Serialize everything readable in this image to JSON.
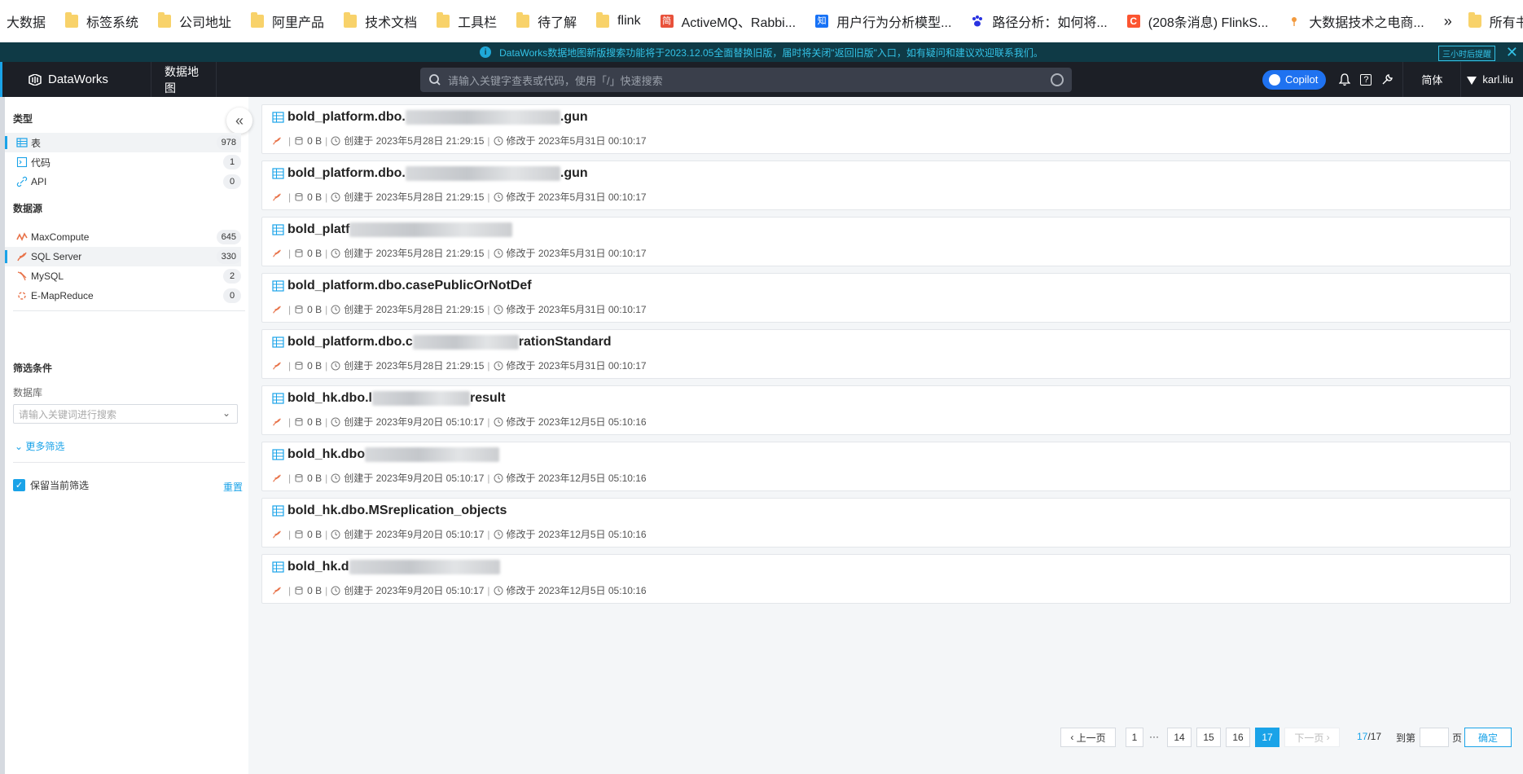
{
  "bookmarks": {
    "items": [
      {
        "label": "大数据",
        "icon": "none"
      },
      {
        "label": "标签系统",
        "icon": "folder-icon"
      },
      {
        "label": "公司地址",
        "icon": "folder-icon"
      },
      {
        "label": "阿里产品",
        "icon": "folder-icon"
      },
      {
        "label": "技术文档",
        "icon": "folder-icon"
      },
      {
        "label": "工具栏",
        "icon": "folder-icon"
      },
      {
        "label": "待了解",
        "icon": "folder-icon"
      },
      {
        "label": "flink",
        "icon": "folder-icon"
      },
      {
        "label": "ActiveMQ、Rabbi...",
        "icon": "site-icon-jian"
      },
      {
        "label": "用户行为分析模型...",
        "icon": "site-icon-zhihu"
      },
      {
        "label": "路径分析：如何将...",
        "icon": "site-icon-baidu"
      },
      {
        "label": "(208条消息) FlinkS...",
        "icon": "site-icon-csdn"
      },
      {
        "label": "大数据技术之电商...",
        "icon": "site-icon-pin"
      }
    ],
    "more": "»",
    "all": "所有书签"
  },
  "notice": {
    "text": "DataWorks数据地图新版搜索功能将于2023.12.05全面替换旧版，届时将关闭\"返回旧版\"入口，如有疑问和建议欢迎联系我们。",
    "button": "三小时后提醒",
    "close": "✕"
  },
  "topbar": {
    "brand": "DataWorks",
    "nav": "数据地图",
    "search_placeholder": "请输入关键字查表或代码，使用「/」快速搜索",
    "copilot": "Copilot",
    "lang": "简体",
    "user": "karl.liu",
    "help_icon": "?"
  },
  "sidebar": {
    "type_title": "类型",
    "types": [
      {
        "label": "表",
        "count": "978",
        "active": true
      },
      {
        "label": "代码",
        "count": "1",
        "active": false
      },
      {
        "label": "API",
        "count": "0",
        "active": false
      }
    ],
    "source_title": "数据源",
    "sources": [
      {
        "label": "MaxCompute",
        "count": "645",
        "active": false
      },
      {
        "label": "SQL Server",
        "count": "330",
        "active": true
      },
      {
        "label": "MySQL",
        "count": "2",
        "active": false
      },
      {
        "label": "E-MapReduce",
        "count": "0",
        "active": false
      }
    ],
    "filter_title": "筛选条件",
    "db_label": "数据库",
    "db_placeholder": "请输入关键词进行搜索",
    "more_filter": "更多筛选",
    "keep_label": "保留当前筛选",
    "reset": "重置",
    "collapse_icon": "«"
  },
  "results": [
    {
      "title_visible": "bold_platform.dbo.",
      "title_tail": ".gun",
      "size": "0 B",
      "created": "创建于 2023年5月28日 21:29:15",
      "modified": "修改于 2023年5月31日 00:10:17"
    },
    {
      "title_visible": "bold_platform.dbo.",
      "title_tail": ".gun",
      "size": "0 B",
      "created": "创建于 2023年5月28日 21:29:15",
      "modified": "修改于 2023年5月31日 00:10:17"
    },
    {
      "title_visible": "bold_platf",
      "title_tail": "",
      "size": "0 B",
      "created": "创建于 2023年5月28日 21:29:15",
      "modified": "修改于 2023年5月31日 00:10:17"
    },
    {
      "title_visible": "bold_platform.dbo.casePublicOrNotDef",
      "title_tail": "",
      "size": "0 B",
      "created": "创建于 2023年5月28日 21:29:15",
      "modified": "修改于 2023年5月31日 00:10:17"
    },
    {
      "title_visible": "bold_platform.dbo.c",
      "title_tail": "rationStandard",
      "size": "0 B",
      "created": "创建于 2023年5月28日 21:29:15",
      "modified": "修改于 2023年5月31日 00:10:17"
    },
    {
      "title_visible": "bold_hk.dbo.l",
      "title_tail": "result",
      "size": "0 B",
      "created": "创建于 2023年9月20日 05:10:17",
      "modified": "修改于 2023年12月5日 05:10:16"
    },
    {
      "title_visible": "bold_hk.dbo",
      "title_tail": "",
      "size": "0 B",
      "created": "创建于 2023年9月20日 05:10:17",
      "modified": "修改于 2023年12月5日 05:10:16"
    },
    {
      "title_visible": "bold_hk.dbo.MSreplication_objects",
      "title_tail": "",
      "size": "0 B",
      "created": "创建于 2023年9月20日 05:10:17",
      "modified": "修改于 2023年12月5日 05:10:16"
    },
    {
      "title_visible": "bold_hk.d",
      "title_tail": "",
      "size": "0 B",
      "created": "创建于 2023年9月20日 05:10:17",
      "modified": "修改于 2023年12月5日 05:10:16"
    }
  ],
  "pagination": {
    "prev": "上一页",
    "first": "1",
    "ellipsis": "···",
    "pages": [
      "14",
      "15",
      "16",
      "17"
    ],
    "current": "17",
    "next": "下一页",
    "total_current": "17",
    "total_sep": "/17",
    "goto_prefix": "到第",
    "goto_suffix": "页",
    "confirm": "确定"
  },
  "colors": {
    "accent": "#1aa3e8",
    "topbar": "#1c1f26",
    "notice_bg": "#0f3a46",
    "copilot": "#1f72f0",
    "sqlserver": "#e8734a"
  }
}
